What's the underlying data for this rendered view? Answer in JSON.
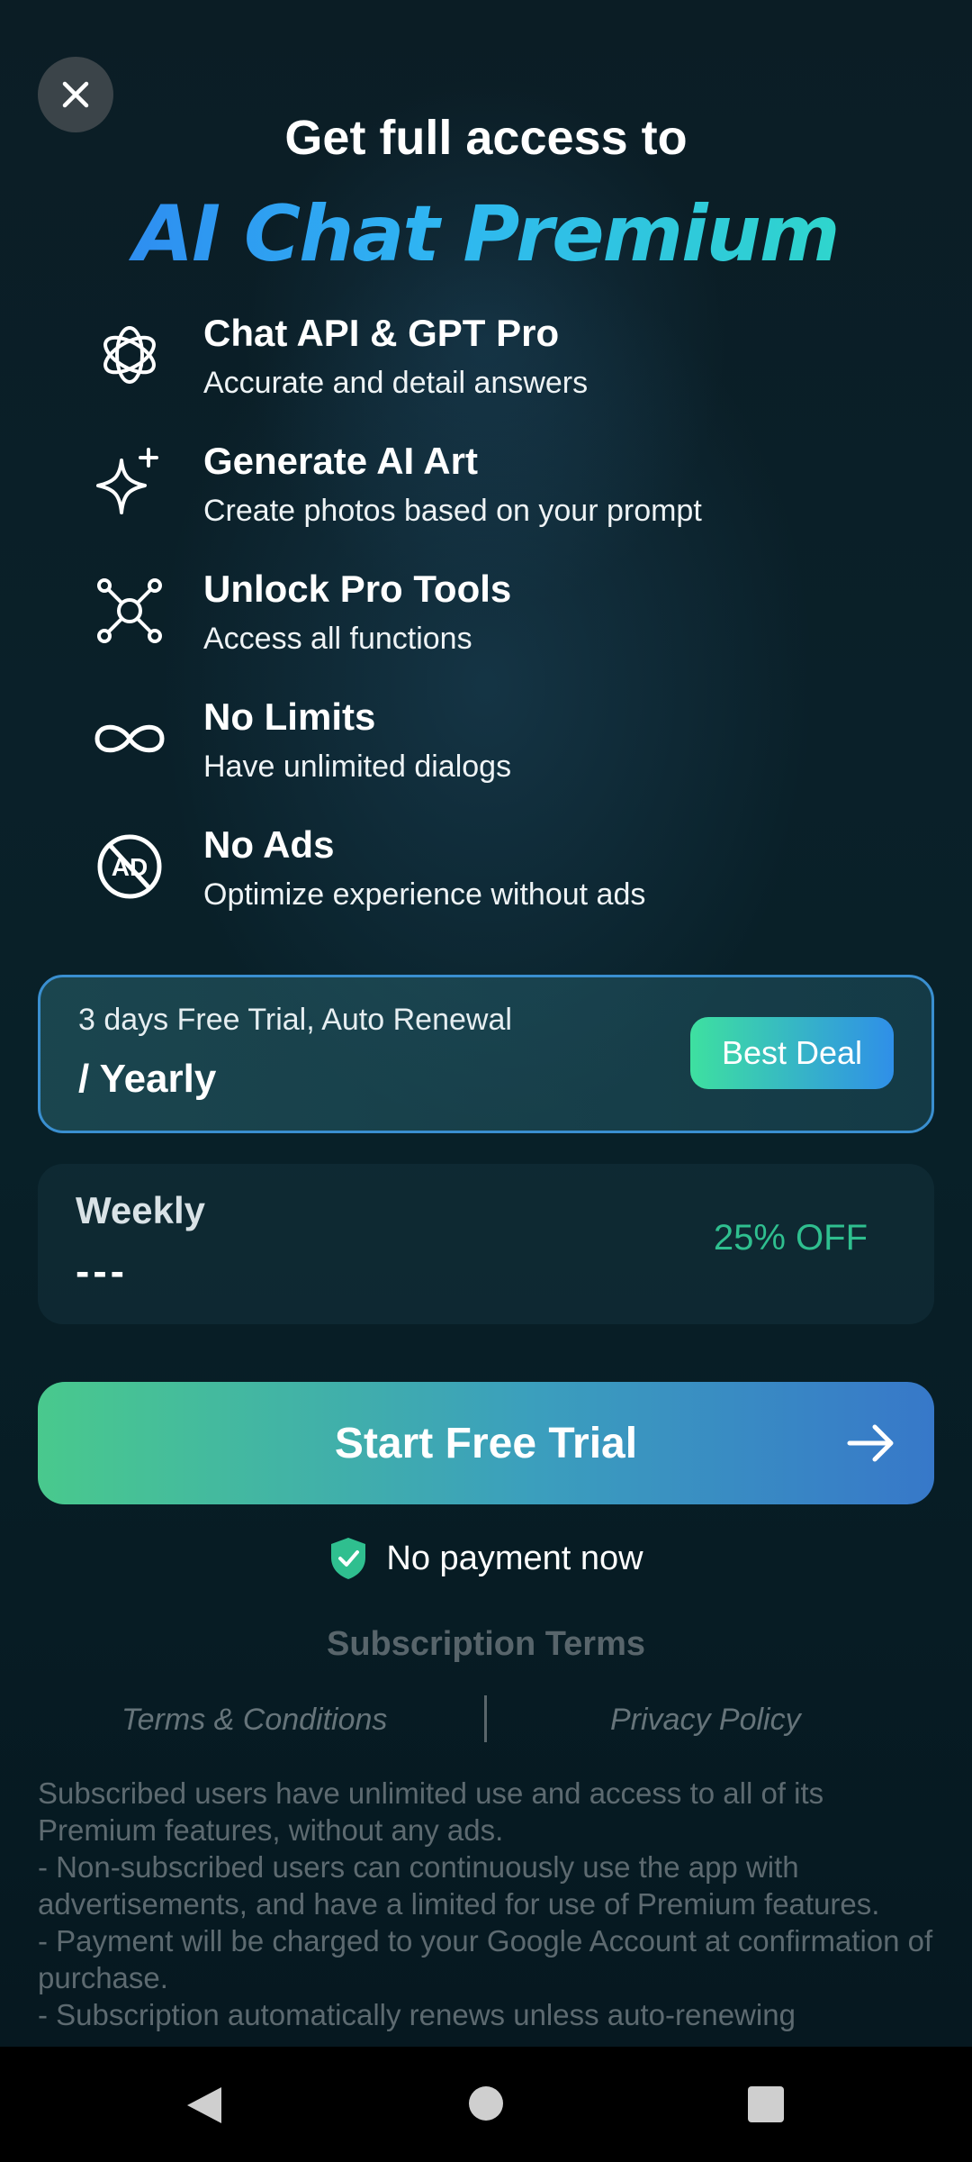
{
  "header": {
    "title": "Get full access to",
    "brand": "AI Chat Premium"
  },
  "features": [
    {
      "icon": "openai-icon",
      "title": "Chat API & GPT Pro",
      "desc": "Accurate and detail answers"
    },
    {
      "icon": "sparkle-icon",
      "title": "Generate AI Art",
      "desc": "Create photos based on your prompt"
    },
    {
      "icon": "network-tools-icon",
      "title": "Unlock Pro Tools",
      "desc": "Access all functions"
    },
    {
      "icon": "infinity-icon",
      "title": "No Limits",
      "desc": "Have unlimited dialogs"
    },
    {
      "icon": "no-ads-icon",
      "title": "No Ads",
      "desc": "Optimize experience without ads"
    }
  ],
  "plans": {
    "yearly": {
      "subtitle": "3 days Free Trial, Auto Renewal",
      "name": "/ Yearly",
      "badge": "Best Deal",
      "selected": true
    },
    "weekly": {
      "name": "Weekly",
      "price": "---",
      "discount": "25% OFF"
    }
  },
  "cta": {
    "label": "Start Free Trial"
  },
  "no_payment": "No payment now",
  "terms": {
    "title": "Subscription Terms",
    "terms_link": "Terms & Conditions",
    "privacy_link": "Privacy Policy",
    "body": "Subscribed users have unlimited use and access to all of its Premium features, without any ads.\n- Non-subscribed users can continuously use the app with advertisements, and have a limited for use of Premium features.\n- Payment will be charged to your Google Account at confirmation of purchase.\n- Subscription automatically renews unless auto-renewing"
  },
  "colors": {
    "accent_green": "#49c98d",
    "accent_blue": "#3778c9",
    "discount": "#2fbf8f",
    "background": "#06161d"
  }
}
